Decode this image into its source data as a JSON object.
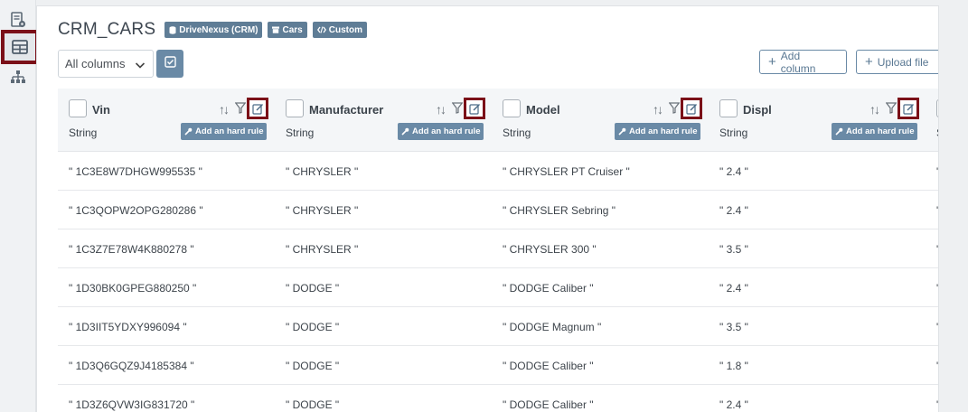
{
  "sidebar": {
    "items": [
      {
        "name": "document-settings-icon"
      },
      {
        "name": "table-icon",
        "active": true
      },
      {
        "name": "network-icon"
      }
    ]
  },
  "header": {
    "title": "CRM_CARS",
    "badges": [
      "DriveNexus (CRM)",
      "Cars",
      "Custom"
    ]
  },
  "toolbar": {
    "column_filter": "All columns",
    "add_column_label": "Add column",
    "upload_label": "Upload file"
  },
  "table": {
    "rule_label": "Add an hard rule",
    "columns": [
      {
        "name": "Vin",
        "type": "String"
      },
      {
        "name": "Manufacturer",
        "type": "String"
      },
      {
        "name": "Model",
        "type": "String"
      },
      {
        "name": "Displ",
        "type": "String"
      }
    ],
    "partial_column_type": "S",
    "rows": [
      [
        "\" 1C3E8W7DHGW995535 \"",
        "\" CHRYSLER \"",
        "\" CHRYSLER PT Cruiser \"",
        "\" 2.4 \""
      ],
      [
        "\" 1C3QOPW2OPG280286 \"",
        "\" CHRYSLER \"",
        "\" CHRYSLER Sebring \"",
        "\" 2.4 \""
      ],
      [
        "\" 1C3Z7E78W4K880278 \"",
        "\" CHRYSLER \"",
        "\" CHRYSLER 300 \"",
        "\" 3.5 \""
      ],
      [
        "\" 1D30BK0GPEG880250 \"",
        "\" DODGE \"",
        "\" DODGE Caliber \"",
        "\" 2.4 \""
      ],
      [
        "\" 1D3IIT5YDXY996094 \"",
        "\" DODGE \"",
        "\" DODGE Magnum \"",
        "\" 3.5 \""
      ],
      [
        "\" 1D3Q6GQZ9J4185384 \"",
        "\" DODGE \"",
        "\" DODGE Caliber \"",
        "\" 1.8 \""
      ],
      [
        "\" 1D3Z6QVW3IG831720 \"",
        "\" DODGE \"",
        "\" DODGE Caliber \"",
        "\" 2.4 \""
      ]
    ],
    "partial_cell": "\""
  },
  "colors": {
    "accent": "#6a8aa6",
    "highlight": "#7b1018",
    "badge": "#5f7d96"
  }
}
